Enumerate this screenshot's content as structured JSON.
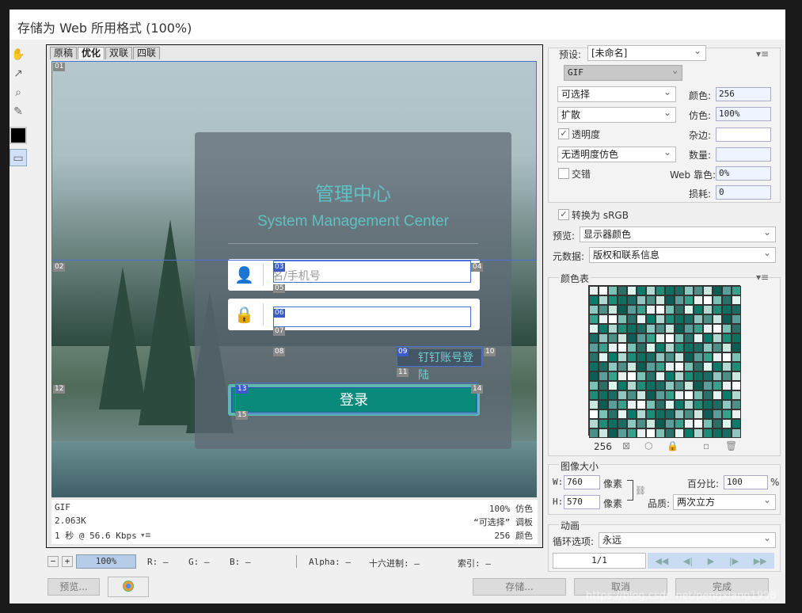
{
  "window": {
    "title": "存储为 Web 所用格式 (100%)"
  },
  "tools": [
    "hand-icon",
    "slice-select-icon",
    "zoom-icon",
    "eyedropper-icon"
  ],
  "tabs": [
    "原稿",
    "优化",
    "双联",
    "四联"
  ],
  "preview": {
    "title_cn": "管理中心",
    "title_en": "System Management Center",
    "username_placeholder": "用户名/手机号",
    "username_visible": "名/手机号",
    "dingtalk_login": "钉钉账号登陆",
    "login_button": "登录"
  },
  "slices": [
    "01",
    "02",
    "03",
    "04",
    "05",
    "06",
    "07",
    "08",
    "09",
    "10",
    "11",
    "12",
    "13",
    "14",
    "15"
  ],
  "info": {
    "format": "GIF",
    "size": "2.063K",
    "speed": "1 秒 @ 56.6 Kbps",
    "dither": "100% 仿色",
    "palette": "“可选择” 调板",
    "colors": "256 颜色"
  },
  "status": {
    "zoom": "100%",
    "r": "R: —",
    "g": "G: —",
    "b": "B: —",
    "alpha": "Alpha: —",
    "hex": "十六进制: —",
    "index": "索引: —"
  },
  "buttons": {
    "preview": "预览...",
    "save": "存储...",
    "cancel": "取消",
    "done": "完成"
  },
  "settings": {
    "preset_label": "预设:",
    "preset_value": "[未命名]",
    "format": "GIF",
    "reduction": "可选择",
    "dither_algo": "扩散",
    "transparency": "透明度",
    "transparency_dither": "无透明度仿色",
    "interlaced": "交错",
    "colors_label": "颜色:",
    "colors_value": "256",
    "dither_label": "仿色:",
    "dither_value": "100%",
    "matte_label": "杂边:",
    "amount_label": "数量:",
    "web_snap_label": "Web 靠色:",
    "web_snap_value": "0%",
    "lossy_label": "损耗:",
    "lossy_value": "0",
    "convert_srgb": "转换为 sRGB",
    "preview_label": "预览:",
    "preview_value": "显示器颜色",
    "metadata_label": "元数据:",
    "metadata_value": "版权和联系信息"
  },
  "color_table": {
    "title": "颜色表",
    "count": "256",
    "colors": [
      "#e8f0f0",
      "#1f8c78",
      "#5a9e9a",
      "#0a7a6a",
      "#c8e8e0",
      "#2a6f68",
      "#8fc7c0",
      "#ffffff",
      "#107060",
      "#3aa08c",
      "#b0d8d0",
      "#0e5d55",
      "#dff5f0",
      "#4b8f86",
      "#7ac0b5",
      "#1b6b63"
    ]
  },
  "image_size": {
    "title": "图像大小",
    "w_label": "W:",
    "w": "760",
    "h_label": "H:",
    "h": "570",
    "px": "像素",
    "percent_label": "百分比:",
    "percent": "100",
    "percent_unit": "%",
    "quality_label": "品质:",
    "quality": "两次立方"
  },
  "animation": {
    "title": "动画",
    "loop_label": "循环选项:",
    "loop": "永远",
    "frame": "1/1"
  },
  "watermark": "https://blog.csdn.net/pengxiang1998"
}
